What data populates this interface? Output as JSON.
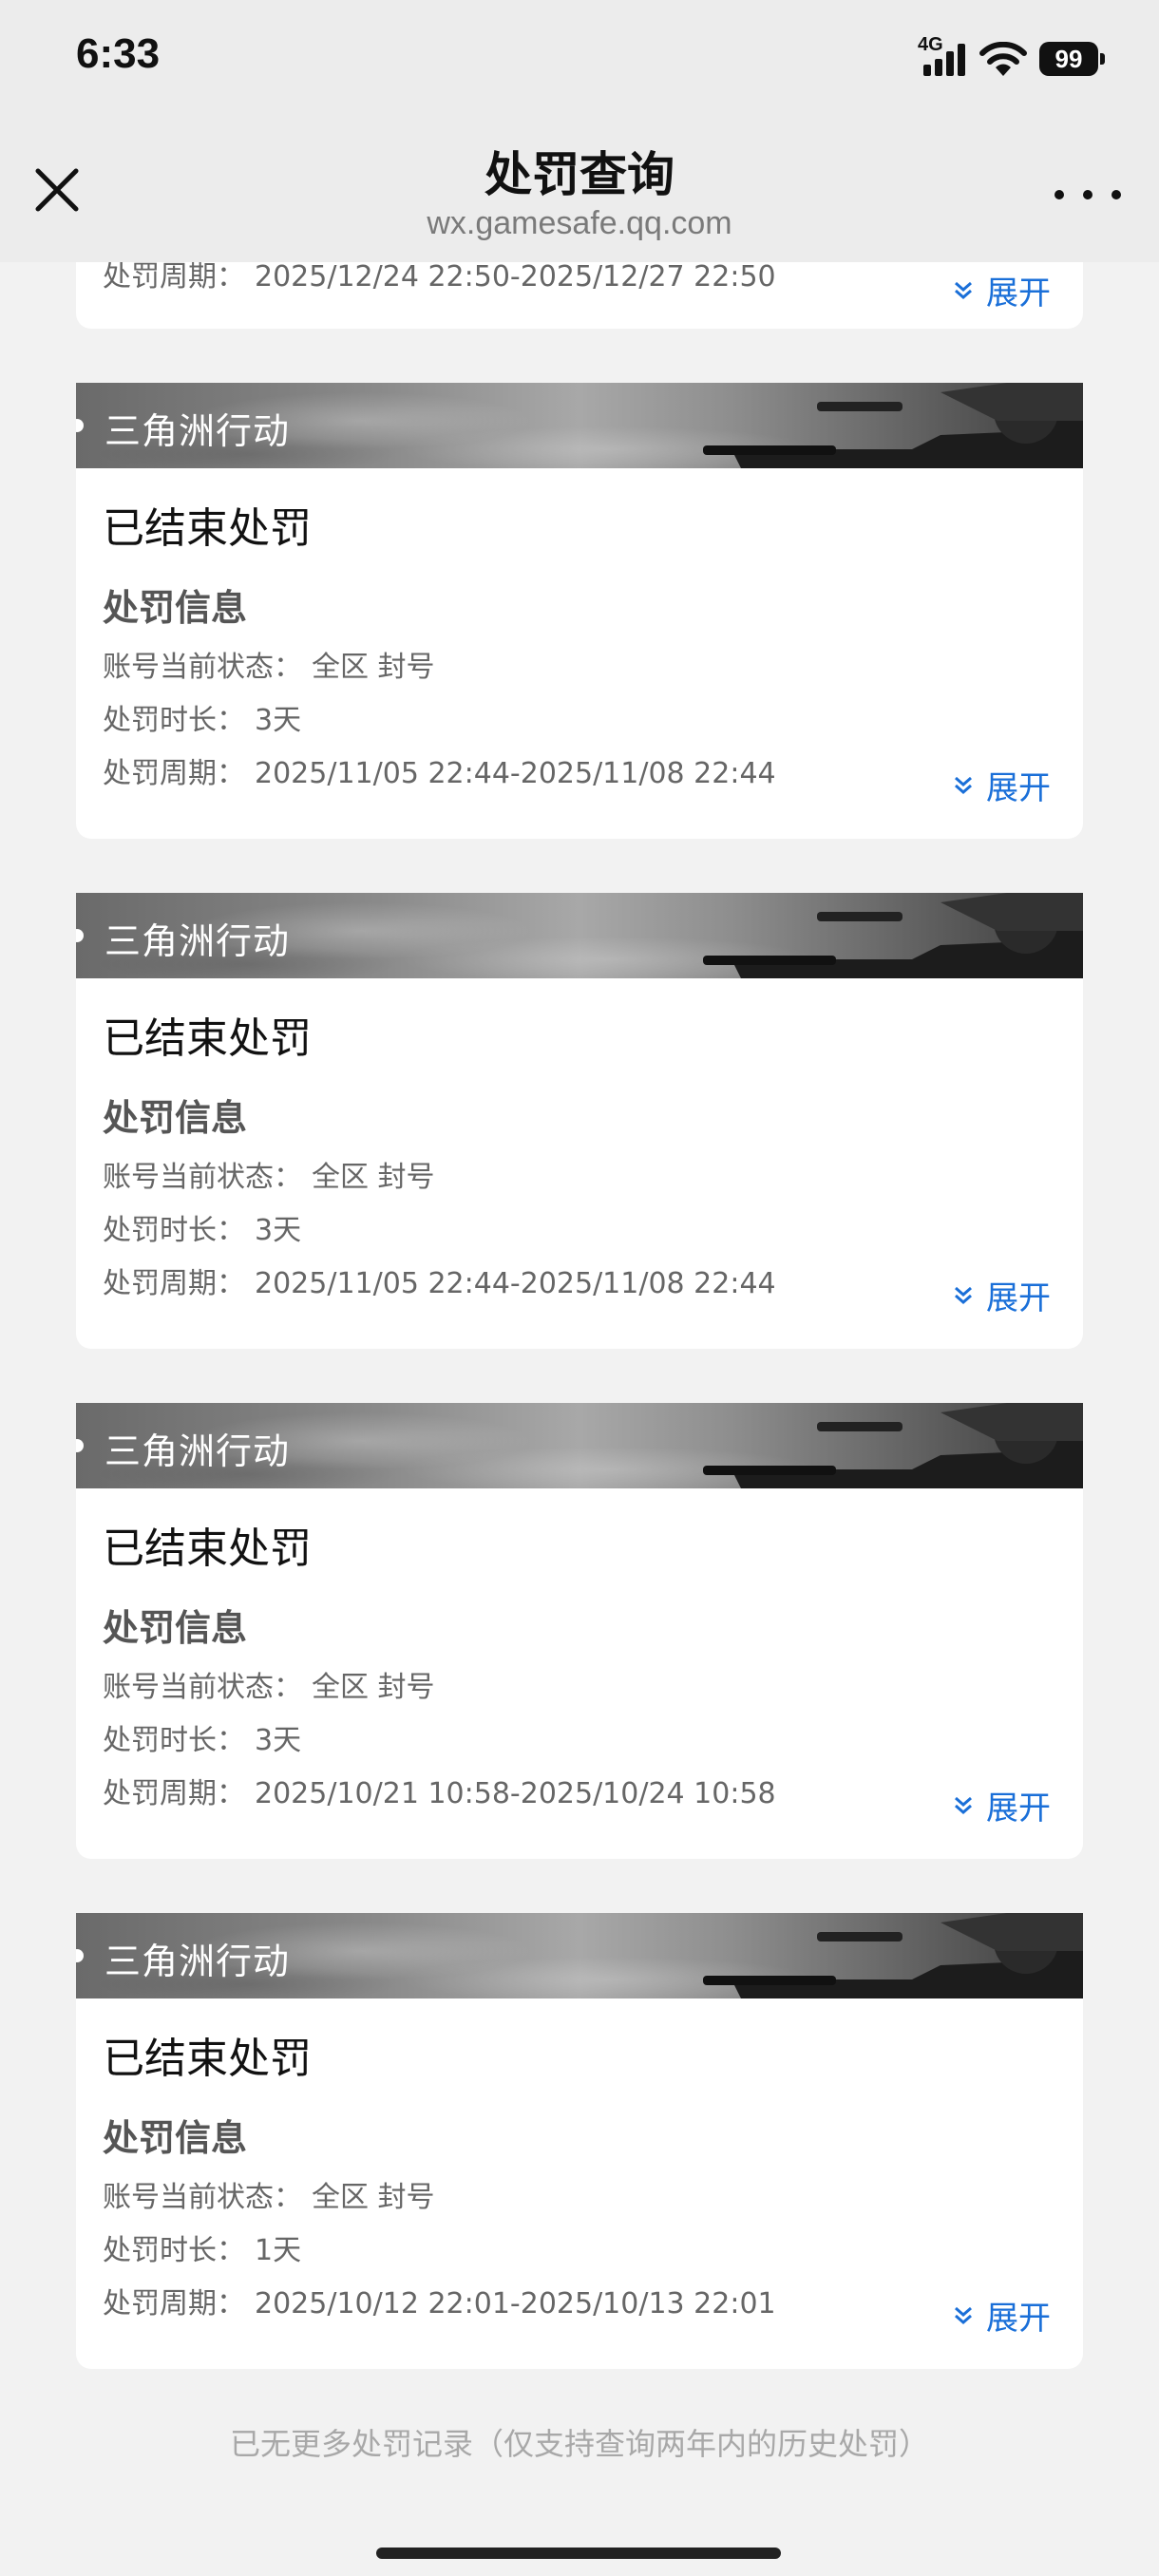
{
  "status_bar": {
    "time": "6:33",
    "network": "4G",
    "battery": "99"
  },
  "nav": {
    "title": "处罚查询",
    "url": "wx.gamesafe.qq.com"
  },
  "top_card": {
    "period_label": "处罚周期：",
    "period_value": "2025/12/24 22:50-2025/12/27 22:50",
    "expand_label": "展开"
  },
  "cards": [
    {
      "game": "三角洲行动",
      "status": "已结束处罚",
      "section": "处罚信息",
      "state_label": "账号当前状态：",
      "state_value": "全区 封号",
      "duration_label": "处罚时长：",
      "duration_value": "3天",
      "period_label": "处罚周期：",
      "period_value": "2025/11/05 22:44-2025/11/08 22:44",
      "expand_label": "展开"
    },
    {
      "game": "三角洲行动",
      "status": "已结束处罚",
      "section": "处罚信息",
      "state_label": "账号当前状态：",
      "state_value": "全区 封号",
      "duration_label": "处罚时长：",
      "duration_value": "3天",
      "period_label": "处罚周期：",
      "period_value": "2025/11/05 22:44-2025/11/08 22:44",
      "expand_label": "展开"
    },
    {
      "game": "三角洲行动",
      "status": "已结束处罚",
      "section": "处罚信息",
      "state_label": "账号当前状态：",
      "state_value": "全区 封号",
      "duration_label": "处罚时长：",
      "duration_value": "3天",
      "period_label": "处罚周期：",
      "period_value": "2025/10/21 10:58-2025/10/24 10:58",
      "expand_label": "展开"
    },
    {
      "game": "三角洲行动",
      "status": "已结束处罚",
      "section": "处罚信息",
      "state_label": "账号当前状态：",
      "state_value": "全区 封号",
      "duration_label": "处罚时长：",
      "duration_value": "1天",
      "period_label": "处罚周期：",
      "period_value": "2025/10/12 22:01-2025/10/13 22:01",
      "expand_label": "展开"
    }
  ],
  "footer": {
    "note": "已无更多处罚记录（仅支持查询两年内的历史处罚）"
  },
  "colors": {
    "accent": "#1a6fd8",
    "background": "#f2f2f2"
  }
}
